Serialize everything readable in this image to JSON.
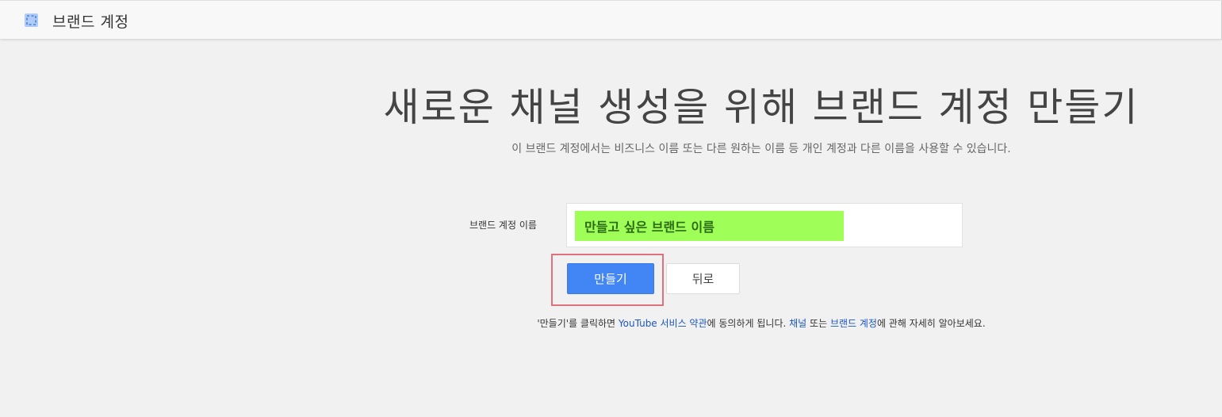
{
  "header": {
    "icon": "brand-account-icon",
    "title": "브랜드 계정"
  },
  "main": {
    "headline": "새로운 채널 생성을 위해 브랜드 계정 만들기",
    "subtitle": "이 브랜드 계정에서는 비즈니스 이름 또는 다른 원하는 이름 등 개인 계정과 다른 이름을 사용할 수 있습니다.",
    "name_field": {
      "label": "브랜드 계정 이름",
      "value": "만들고 싶은 브랜드 이름"
    },
    "buttons": {
      "create": "만들기",
      "back": "뒤로"
    },
    "terms": {
      "prefix": "'만들기'를 클릭하면 ",
      "tos_link": "YouTube 서비스 약관",
      "middle": "에 동의하게 됩니다. ",
      "channel_link": "채널",
      "or_text": " 또는 ",
      "brand_link": "브랜드 계정",
      "suffix": "에 관해 자세히 알아보세요."
    }
  },
  "colors": {
    "accent_button": "#4285f4",
    "highlight_input": "#9ffe57",
    "highlight_frame": "#e0707b",
    "link": "#1a56c2"
  }
}
